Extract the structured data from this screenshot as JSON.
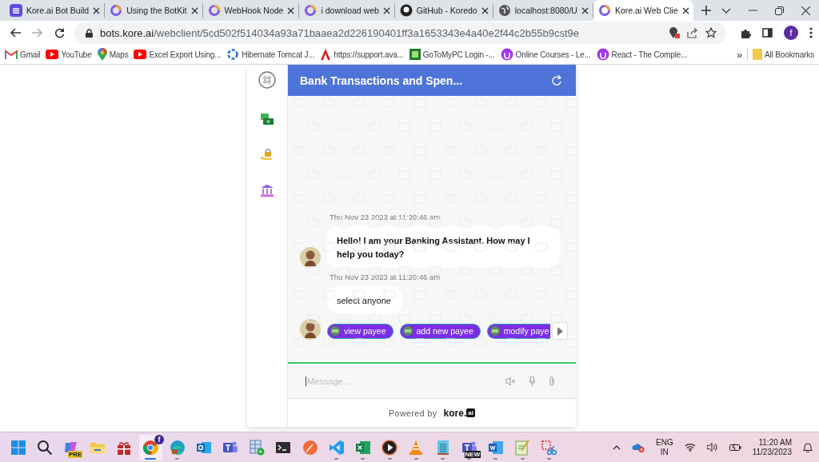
{
  "browser": {
    "tabs": [
      {
        "title": "Kore.ai Bot Build",
        "kind": "kore",
        "selected": false
      },
      {
        "title": "Using the BotKit",
        "kind": "ring",
        "selected": false
      },
      {
        "title": "WebHook Node",
        "kind": "ring",
        "selected": false
      },
      {
        "title": "i download web",
        "kind": "ring",
        "selected": false
      },
      {
        "title": "GitHub - Koredo",
        "kind": "github",
        "selected": false
      },
      {
        "title": "localhost:8080/U",
        "kind": "globe",
        "selected": false
      },
      {
        "title": "Kore.ai Web Clie",
        "kind": "ring",
        "selected": true
      }
    ],
    "url": {
      "host": "bots.kore.ai",
      "path": "/webclient/5cd502f514034a93a71baaea2d226190401ff3a1653343e4a40e2f44c2b55b9cst9e"
    },
    "profile": "f",
    "bookmarks": [
      {
        "label": "Gmail",
        "kind": "gmail"
      },
      {
        "label": "YouTube",
        "kind": "youtube"
      },
      {
        "label": "Maps",
        "kind": "maps"
      },
      {
        "label": "Excel Export Using...",
        "kind": "youtube"
      },
      {
        "label": "Hibernate Tomcat J...",
        "kind": "spinner"
      },
      {
        "label": "https://support.ava...",
        "kind": "angular"
      },
      {
        "label": "GoToMyPC Login -...",
        "kind": "gotomypc"
      },
      {
        "label": "Online Courses - Le...",
        "kind": "udemy"
      },
      {
        "label": "React - The Comple...",
        "kind": "udemy"
      }
    ],
    "bookmarks_overflow": "»",
    "all_bookmarks": "All Bookmarks"
  },
  "chat": {
    "title": "Bank Transactions and Spen...",
    "rail": [
      {
        "kind": "menu"
      },
      {
        "kind": "money"
      },
      {
        "kind": "hand-lock"
      },
      {
        "kind": "bank"
      }
    ],
    "messages": [
      {
        "timestamp": "Thu Nov 23 2023 at 11:20:46 am",
        "text": "Hello! I am your Banking Assistant. How may I help you today?",
        "bold": true
      },
      {
        "timestamp": "Thu Nov 23 2023 at 11:20:46 am",
        "text": "select anyone",
        "bold": false,
        "quick_replies": [
          "view payee",
          "add new payee",
          "modify paye"
        ]
      }
    ],
    "input": {
      "placeholder": "Message..."
    },
    "footer": {
      "label": "Powered by",
      "logo_word": "kore.",
      "logo_box": "ai"
    }
  },
  "taskbar": {
    "apps": [
      {
        "kind": "start",
        "running": false,
        "selected": false
      },
      {
        "kind": "search",
        "running": false,
        "selected": false
      },
      {
        "kind": "copilot",
        "badge": "PRE",
        "running": false,
        "selected": false
      },
      {
        "kind": "folder",
        "running": false,
        "selected": false
      },
      {
        "kind": "gift",
        "running": false,
        "selected": false
      },
      {
        "kind": "chrome",
        "badge": "f",
        "running": true,
        "selected": true
      },
      {
        "kind": "edge",
        "running": true,
        "selected": false
      },
      {
        "kind": "outlook",
        "running": false,
        "selected": false
      },
      {
        "kind": "teams",
        "running": false,
        "selected": false
      },
      {
        "kind": "table",
        "running": false,
        "selected": false
      },
      {
        "kind": "terminal",
        "running": false,
        "selected": false
      },
      {
        "kind": "pen",
        "running": false,
        "selected": false
      },
      {
        "kind": "vscode",
        "running": true,
        "selected": false
      },
      {
        "kind": "excel",
        "running": true,
        "selected": false
      },
      {
        "kind": "player",
        "running": true,
        "selected": false
      },
      {
        "kind": "vlc",
        "running": true,
        "selected": false
      },
      {
        "kind": "notepad",
        "running": true,
        "selected": false
      },
      {
        "kind": "teams",
        "badge": "NEW",
        "running": true,
        "selected": false
      },
      {
        "kind": "word",
        "running": true,
        "selected": false
      },
      {
        "kind": "editor",
        "running": true,
        "selected": false
      },
      {
        "kind": "snip",
        "running": true,
        "selected": false
      }
    ],
    "language": "ENG",
    "region": "IN",
    "time": "11:20 AM",
    "date": "11/23/2023"
  }
}
